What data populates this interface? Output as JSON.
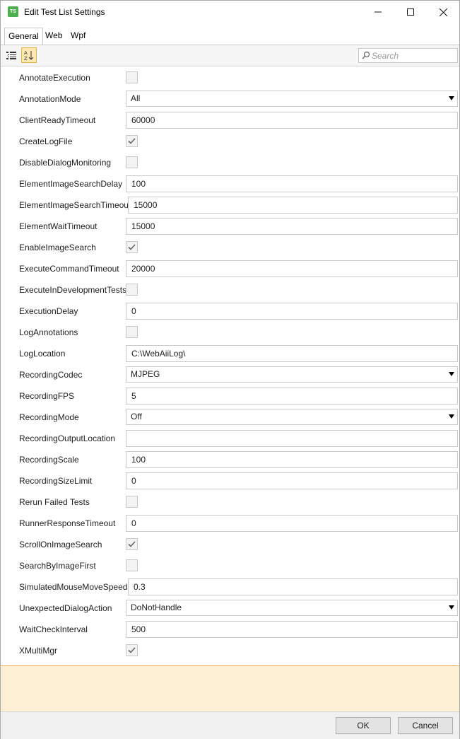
{
  "window": {
    "title": "Edit Test List Settings",
    "app_icon_text": "TS",
    "app_icon_color": "#4cae4c"
  },
  "tabs": [
    {
      "label": "General",
      "active": true
    },
    {
      "label": "Web",
      "active": false
    },
    {
      "label": "Wpf",
      "active": false
    }
  ],
  "toolbar": {
    "categorized_icon": "categorized-list-icon",
    "alphabetical_icon": "alphabetical-sort-icon",
    "active_button": "alphabetical",
    "search_placeholder": "Search"
  },
  "properties": [
    {
      "name": "AnnotateExecution",
      "type": "check",
      "checked": false
    },
    {
      "name": "AnnotationMode",
      "type": "combo",
      "value": "All"
    },
    {
      "name": "ClientReadyTimeout",
      "type": "text",
      "value": "60000"
    },
    {
      "name": "CreateLogFile",
      "type": "check",
      "checked": true
    },
    {
      "name": "DisableDialogMonitoring",
      "type": "check",
      "checked": false
    },
    {
      "name": "ElementImageSearchDelay",
      "type": "text",
      "value": "100"
    },
    {
      "name": "ElementImageSearchTimeout",
      "type": "text",
      "value": "15000",
      "wide_label": true
    },
    {
      "name": "ElementWaitTimeout",
      "type": "text",
      "value": "15000"
    },
    {
      "name": "EnableImageSearch",
      "type": "check",
      "checked": true
    },
    {
      "name": "ExecuteCommandTimeout",
      "type": "text",
      "value": "20000"
    },
    {
      "name": "ExecuteInDevelopmentTests",
      "type": "check",
      "checked": false
    },
    {
      "name": "ExecutionDelay",
      "type": "text",
      "value": "0"
    },
    {
      "name": "LogAnnotations",
      "type": "check",
      "checked": false
    },
    {
      "name": "LogLocation",
      "type": "text",
      "value": "C:\\WebAiiLog\\"
    },
    {
      "name": "RecordingCodec",
      "type": "combo",
      "value": "MJPEG"
    },
    {
      "name": "RecordingFPS",
      "type": "text",
      "value": "5"
    },
    {
      "name": "RecordingMode",
      "type": "combo",
      "value": "Off"
    },
    {
      "name": "RecordingOutputLocation",
      "type": "text",
      "value": ""
    },
    {
      "name": "RecordingScale",
      "type": "text",
      "value": "100"
    },
    {
      "name": "RecordingSizeLimit",
      "type": "text",
      "value": "0"
    },
    {
      "name": "Rerun Failed Tests",
      "type": "check",
      "checked": false
    },
    {
      "name": "RunnerResponseTimeout",
      "type": "text",
      "value": "0"
    },
    {
      "name": "ScrollOnImageSearch",
      "type": "check",
      "checked": true
    },
    {
      "name": "SearchByImageFirst",
      "type": "check",
      "checked": false
    },
    {
      "name": "SimulatedMouseMoveSpeed",
      "type": "text",
      "value": "0.3",
      "wide_label": true
    },
    {
      "name": "UnexpectedDialogAction",
      "type": "combo",
      "value": "DoNotHandle"
    },
    {
      "name": "WaitCheckInterval",
      "type": "text",
      "value": "500"
    },
    {
      "name": "XMultiMgr",
      "type": "check",
      "checked": true
    }
  ],
  "info_panel": {
    "background": "#fdf0d5",
    "border": "#f2a854"
  },
  "footer": {
    "ok_label": "OK",
    "cancel_label": "Cancel"
  }
}
